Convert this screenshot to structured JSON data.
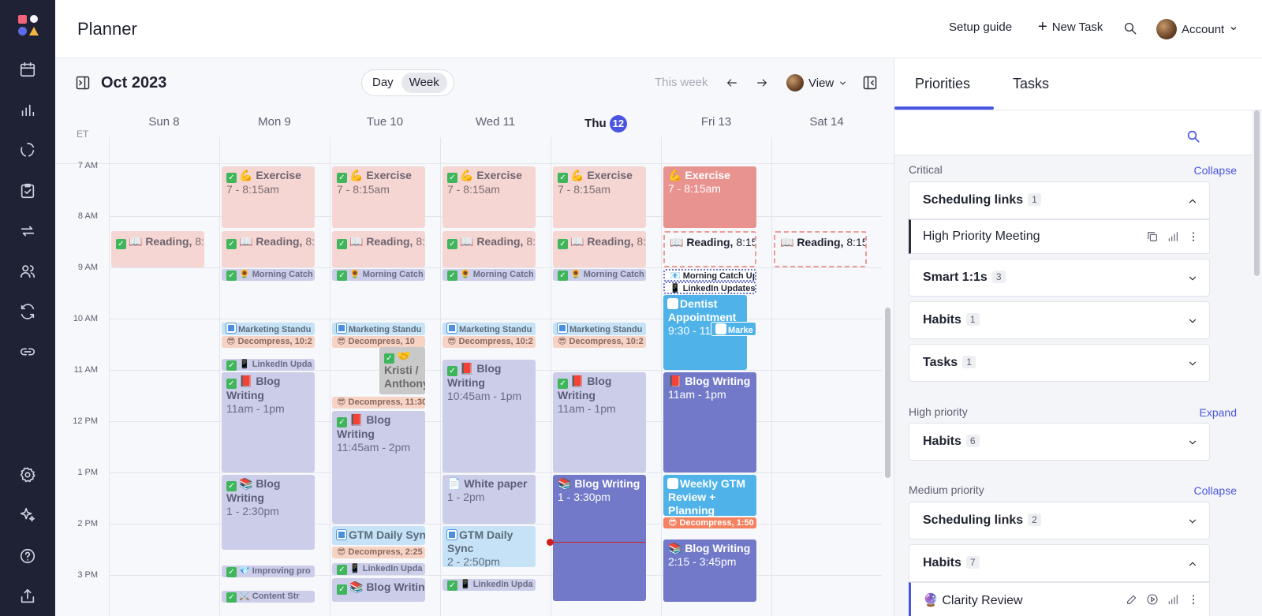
{
  "app": {
    "title": "Planner"
  },
  "topbar": {
    "setup_guide": "Setup guide",
    "new_task": "New Task",
    "account": "Account"
  },
  "calendar": {
    "month": "Oct 2023",
    "views": [
      "Day",
      "Week"
    ],
    "active_view": "Week",
    "this_week": "This week",
    "view_label": "View",
    "timezone": "ET",
    "days": [
      {
        "label": "Sun 8"
      },
      {
        "label": "Mon 9"
      },
      {
        "label": "Tue 10"
      },
      {
        "label": "Wed 11"
      },
      {
        "label": "Thu",
        "num": "12",
        "today": true
      },
      {
        "label": "Fri 13"
      },
      {
        "label": "Sat 14"
      }
    ],
    "hours": [
      "7 AM",
      "8 AM",
      "9 AM",
      "10 AM",
      "11 AM",
      "12 PM",
      "1 PM",
      "2 PM",
      "3 PM"
    ],
    "events": {
      "exercise_title": "💪 Exercise",
      "exercise_time": "7 - 8:15am",
      "reading_title": "📖 Reading,",
      "reading_time": "8:1",
      "reading_time_fri": "8:15",
      "morning_catch": "🌻 Morning Catch",
      "morning_catch_fri": "📧 Morning Catch Up",
      "linkedin_fri": "📱 LinkedIn Updates",
      "marketing": "Marketing Standu",
      "marketing_fri": "Marke",
      "decompress": "😎 Decompress,",
      "decompress_mon": "10:2",
      "decompress_tue": "10",
      "decompress_tue2": "11:30",
      "decompress_tue3": "2:25",
      "decompress_fri": "1:50",
      "linkedin": "📱 LinkedIn Upda",
      "blog_title": "📕 Blog Writing",
      "blog_title2": "📚 Blog Writing",
      "blog_mon1": "11am - 1pm",
      "blog_mon2": "1 - 2:30pm",
      "blog_tue": "11:45am - 2pm",
      "blog_wed": "10:45am - 1pm",
      "blog_thu1": "11am - 1pm",
      "blog_thu2": "1 - 3:30pm",
      "blog_fri1": "11am - 1pm",
      "blog_fri2": "2:15 - 3:45pm",
      "kristi": "🤝 Kristi / Anthony",
      "white_paper": "📄 White paper",
      "white_paper_time": "1 - 2pm",
      "gtm_daily": "GTM Daily Sync",
      "gtm_daily_wed": "GTM Daily Sync",
      "gtm_daily_wed_time": "2 - 2:50pm",
      "dentist": "Dentist Appointment",
      "dentist_time": "9:30 - 11",
      "weekly_gtm": "Weekly GTM Review + Planning",
      "improving": "💎 Improving pro",
      "content": "⚔️ Content Str"
    }
  },
  "priorities": {
    "tabs": [
      "Priorities",
      "Tasks"
    ],
    "critical": {
      "label": "Critical",
      "action": "Collapse"
    },
    "critical_groups": [
      {
        "label": "Scheduling links",
        "count": "1",
        "expanded": true
      },
      {
        "label": "Smart 1:1s",
        "count": "3"
      },
      {
        "label": "Habits",
        "count": "1"
      },
      {
        "label": "Tasks",
        "count": "1"
      }
    ],
    "critical_item": "High Priority Meeting",
    "high": {
      "label": "High priority",
      "action": "Expand"
    },
    "high_groups": [
      {
        "label": "Habits",
        "count": "6"
      }
    ],
    "medium": {
      "label": "Medium priority",
      "action": "Collapse"
    },
    "medium_groups": [
      {
        "label": "Scheduling links",
        "count": "2"
      },
      {
        "label": "Habits",
        "count": "7",
        "expanded": true
      }
    ],
    "medium_item": "🔮 Clarity Review"
  }
}
